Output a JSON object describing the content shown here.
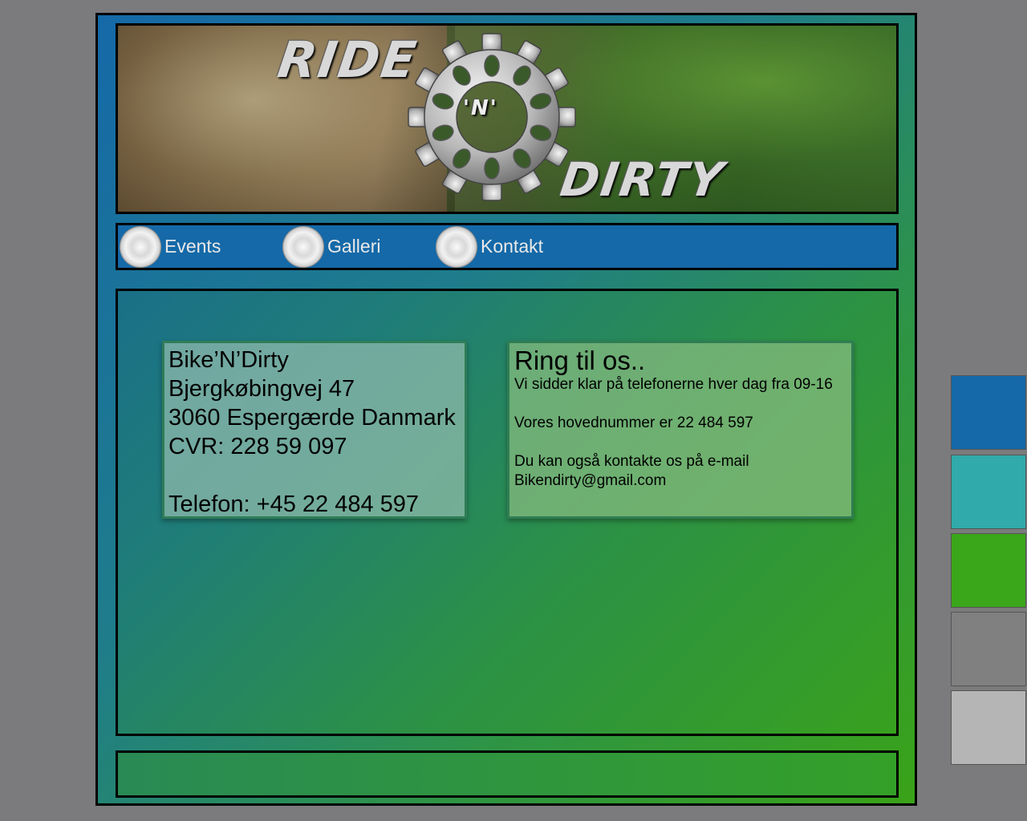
{
  "logo": {
    "ride": "RIDE",
    "n": "'N'",
    "dirty": "DIRTY"
  },
  "nav": [
    {
      "label": "Events"
    },
    {
      "label": "Galleri"
    },
    {
      "label": "Kontakt"
    }
  ],
  "address": {
    "name": "Bike’N’Dirty",
    "street": "Bjergkøbingvej 47",
    "city": "3060 Espergærde Danmark",
    "cvr": "CVR: 228 59 097",
    "phone": "Telefon: +45 22 484 597"
  },
  "contact": {
    "title": "Ring til os..",
    "hours": "Vi sidder klar på telefonerne hver dag fra 09-16",
    "main_number": "Vores hovednummer er 22 484 597",
    "email_text": "Du kan også kontakte os på e-mail",
    "email": "Bikendirty@gmail.com"
  },
  "palette": [
    "#1569a8",
    "#30aaaa",
    "#3aa61a",
    "#808080",
    "#b5b5b5"
  ]
}
